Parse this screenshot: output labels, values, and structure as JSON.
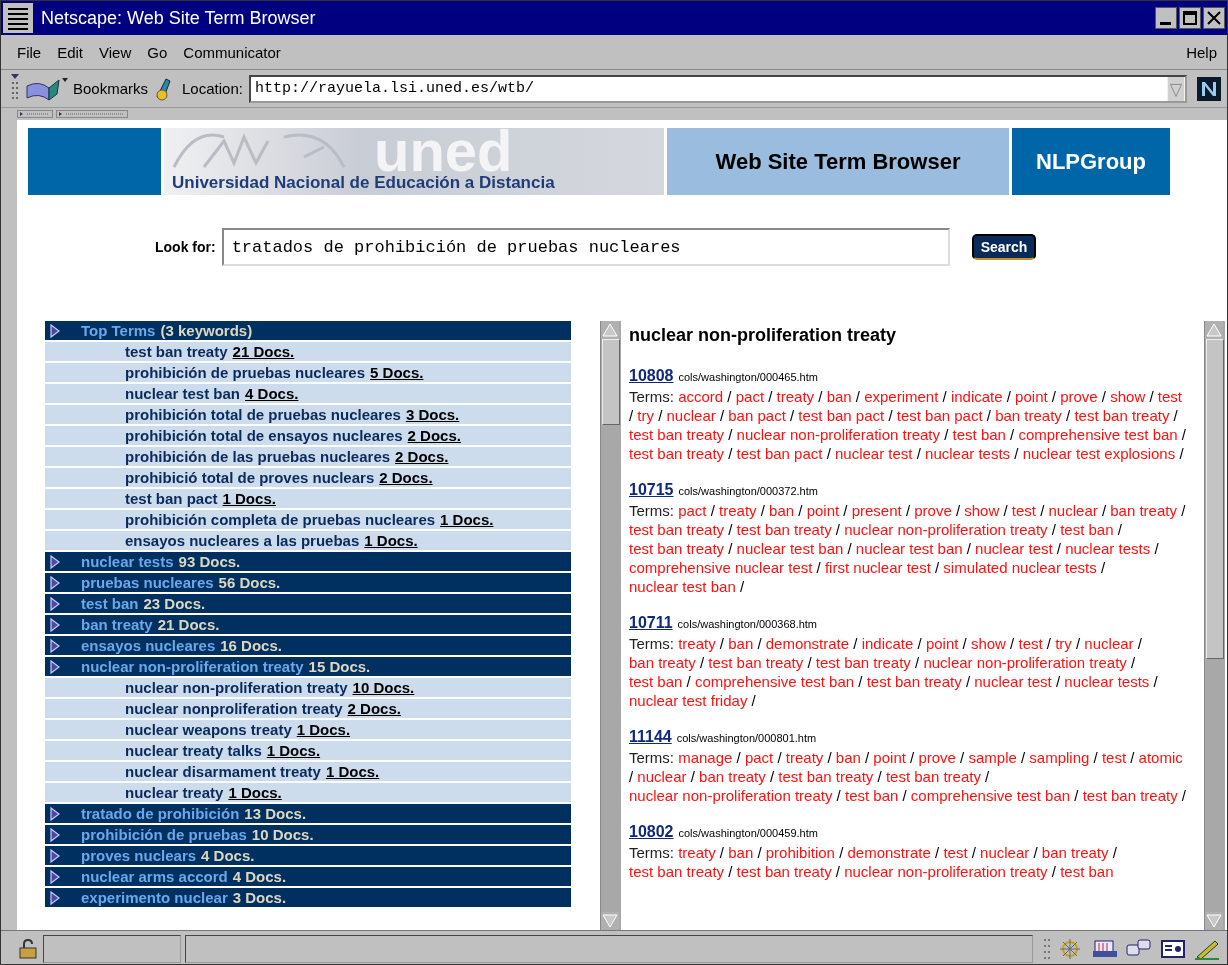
{
  "window": {
    "title": "Netscape: Web Site Term Browser"
  },
  "menu": {
    "items": [
      "File",
      "Edit",
      "View",
      "Go",
      "Communicator"
    ],
    "help": "Help"
  },
  "location_bar": {
    "bookmarks": "Bookmarks",
    "location_label": "Location:",
    "url": "http://rayuela.lsi.uned.es/wtb/"
  },
  "banner": {
    "logo_word": "uned",
    "university": "Universidad Nacional de Educación a Distancia",
    "title": "Web Site Term Browser",
    "group": "NLPGroup"
  },
  "search": {
    "label": "Look for:",
    "value": "tratados de prohibición de pruebas nucleares",
    "button": "Search"
  },
  "tree": [
    {
      "term": "Top Terms",
      "docs": "(3 keywords)",
      "children": [
        {
          "term": "test ban treaty",
          "docs": "21 Docs."
        },
        {
          "term": "prohibición de pruebas nucleares",
          "docs": "5 Docs."
        },
        {
          "term": "nuclear test ban",
          "docs": "4 Docs."
        },
        {
          "term": "prohibición total de pruebas nucleares",
          "docs": "3 Docs."
        },
        {
          "term": "prohibición total de ensayos nucleares",
          "docs": "2 Docs."
        },
        {
          "term": "prohibición de las pruebas nucleares",
          "docs": "2 Docs."
        },
        {
          "term": "prohibició total de proves nuclears",
          "docs": "2 Docs."
        },
        {
          "term": "test ban pact",
          "docs": "1 Docs."
        },
        {
          "term": "prohibición completa de pruebas nucleares",
          "docs": "1 Docs."
        },
        {
          "term": "ensayos nucleares a las pruebas",
          "docs": "1 Docs."
        }
      ]
    },
    {
      "term": "nuclear tests",
      "docs": "93 Docs."
    },
    {
      "term": "pruebas nucleares",
      "docs": "56 Docs."
    },
    {
      "term": "test ban",
      "docs": "23 Docs."
    },
    {
      "term": "ban treaty",
      "docs": "21 Docs."
    },
    {
      "term": "ensayos nucleares",
      "docs": "16 Docs."
    },
    {
      "term": "nuclear non-proliferation treaty",
      "docs": "15 Docs.",
      "children": [
        {
          "term": "nuclear non-proliferation treaty",
          "docs": "10 Docs."
        },
        {
          "term": "nuclear nonproliferation treaty",
          "docs": "2 Docs."
        },
        {
          "term": "nuclear weapons treaty",
          "docs": "1 Docs."
        },
        {
          "term": "nuclear treaty talks",
          "docs": "1 Docs."
        },
        {
          "term": "nuclear disarmament treaty",
          "docs": "1 Docs."
        },
        {
          "term": "nuclear treaty",
          "docs": "1 Docs."
        }
      ]
    },
    {
      "term": "tratado de prohibición",
      "docs": "13 Docs."
    },
    {
      "term": "prohibición de pruebas",
      "docs": "10 Docs."
    },
    {
      "term": "proves nuclears",
      "docs": "4 Docs."
    },
    {
      "term": "nuclear arms accord",
      "docs": "4 Docs."
    },
    {
      "term": "experimento nuclear",
      "docs": "3 Docs."
    }
  ],
  "results": {
    "heading": "nuclear non-proliferation treaty",
    "docs": [
      {
        "id": "10808",
        "path": "cols/washington/000465.htm",
        "terms_label": "Terms:",
        "terms": [
          {
            "term": "accord",
            "sep": "/"
          },
          {
            "term": "pact",
            "sep": "/"
          },
          {
            "term": "treaty",
            "sep": "/"
          },
          {
            "term": "ban",
            "sep": "/"
          },
          {
            "term": "experiment",
            "sep": "/"
          },
          {
            "term": "indicate",
            "sep": "/"
          },
          {
            "term": "point",
            "sep": "/"
          },
          {
            "term": "prove",
            "sep": "/"
          },
          {
            "term": "show",
            "sep": "/"
          },
          {
            "term": "test",
            "sep": "/"
          },
          {
            "term": "try",
            "sep": "/"
          },
          {
            "term": "nuclear",
            "sep": "/"
          },
          {
            "term": "ban pact",
            "sep": "/"
          },
          {
            "term": "test ban pact",
            "sep": "/"
          },
          {
            "term": "test ban pact",
            "sep": "/"
          },
          {
            "term": "ban treaty",
            "sep": "/"
          },
          {
            "term": "test ban treaty",
            "sep": "/"
          },
          {
            "term": "test ban treaty",
            "sep": "/"
          },
          {
            "term": "nuclear non-proliferation treaty",
            "sep": "/"
          },
          {
            "term": "test ban",
            "sep": "/"
          },
          {
            "term": "comprehensive test ban",
            "sep": "/"
          },
          {
            "term": "test ban treaty",
            "sep": "/"
          },
          {
            "term": "test ban pact",
            "sep": "/"
          },
          {
            "term": "nuclear test",
            "sep": "/"
          },
          {
            "term": "nuclear tests",
            "sep": "/"
          },
          {
            "term": "nuclear test explosions",
            "sep": "/"
          }
        ]
      },
      {
        "id": "10715",
        "path": "cols/washington/000372.htm",
        "terms_label": "Terms:",
        "terms": [
          {
            "term": "pact",
            "sep": "/"
          },
          {
            "term": "treaty",
            "sep": "/"
          },
          {
            "term": "ban",
            "sep": "/"
          },
          {
            "term": "point",
            "sep": "/"
          },
          {
            "term": "present",
            "sep": "/"
          },
          {
            "term": "prove",
            "sep": "/"
          },
          {
            "term": "show",
            "sep": "/"
          },
          {
            "term": "test",
            "sep": "/"
          },
          {
            "term": "nuclear",
            "sep": "/"
          },
          {
            "term": "ban treaty",
            "sep": "/"
          },
          {
            "term": "test ban treaty",
            "sep": "/"
          },
          {
            "term": "test ban treaty",
            "sep": "/"
          },
          {
            "term": "nuclear non-proliferation treaty",
            "sep": "/"
          },
          {
            "term": "test ban",
            "sep": "/"
          },
          {
            "term": "test ban treaty",
            "sep": "/"
          },
          {
            "term": "nuclear test ban",
            "sep": "/"
          },
          {
            "term": "nuclear test ban",
            "sep": "/"
          },
          {
            "term": "nuclear test",
            "sep": "/"
          },
          {
            "term": "nuclear tests",
            "sep": "/"
          },
          {
            "term": "comprehensive nuclear test",
            "sep": "/"
          },
          {
            "term": "first nuclear test",
            "sep": "/"
          },
          {
            "term": "simulated nuclear tests",
            "sep": "/"
          },
          {
            "term": "nuclear test ban",
            "sep": "/"
          }
        ]
      },
      {
        "id": "10711",
        "path": "cols/washington/000368.htm",
        "terms_label": "Terms:",
        "terms": [
          {
            "term": "treaty",
            "sep": "/"
          },
          {
            "term": "ban",
            "sep": "/"
          },
          {
            "term": "demonstrate",
            "sep": "/"
          },
          {
            "term": "indicate",
            "sep": "/"
          },
          {
            "term": "point",
            "sep": "/"
          },
          {
            "term": "show",
            "sep": "/"
          },
          {
            "term": "test",
            "sep": "/"
          },
          {
            "term": "try",
            "sep": "/"
          },
          {
            "term": "nuclear",
            "sep": "/"
          },
          {
            "term": "ban treaty",
            "sep": "/"
          },
          {
            "term": "test ban treaty",
            "sep": "/"
          },
          {
            "term": "test ban treaty",
            "sep": "/"
          },
          {
            "term": "nuclear non-proliferation treaty",
            "sep": "/"
          },
          {
            "term": "test ban",
            "sep": "/"
          },
          {
            "term": "comprehensive test ban",
            "sep": "/"
          },
          {
            "term": "test ban treaty",
            "sep": "/"
          },
          {
            "term": "nuclear test",
            "sep": "/"
          },
          {
            "term": "nuclear tests",
            "sep": "/"
          },
          {
            "term": "nuclear test friday",
            "sep": "/"
          }
        ]
      },
      {
        "id": "11144",
        "path": "cols/washington/000801.htm",
        "terms_label": "Terms:",
        "terms": [
          {
            "term": "manage",
            "sep": "/"
          },
          {
            "term": "pact",
            "sep": "/"
          },
          {
            "term": "treaty",
            "sep": "/"
          },
          {
            "term": "ban",
            "sep": "/"
          },
          {
            "term": "point",
            "sep": "/"
          },
          {
            "term": "prove",
            "sep": "/"
          },
          {
            "term": "sample",
            "sep": "/"
          },
          {
            "term": "sampling",
            "sep": "/"
          },
          {
            "term": "test",
            "sep": "/"
          },
          {
            "term": "atomic",
            "sep": "/"
          },
          {
            "term": "nuclear",
            "sep": "/"
          },
          {
            "term": "ban treaty",
            "sep": "/"
          },
          {
            "term": "test ban treaty",
            "sep": "/"
          },
          {
            "term": "test ban treaty",
            "sep": "/"
          },
          {
            "term": "nuclear non-proliferation treaty",
            "sep": "/"
          },
          {
            "term": "test ban",
            "sep": "/"
          },
          {
            "term": "comprehensive test ban",
            "sep": "/"
          },
          {
            "term": "test ban treaty",
            "sep": "/"
          }
        ]
      },
      {
        "id": "10802",
        "path": "cols/washington/000459.htm",
        "terms_label": "Terms:",
        "terms": [
          {
            "term": "treaty",
            "sep": "/"
          },
          {
            "term": "ban",
            "sep": "/"
          },
          {
            "term": "prohibition",
            "sep": "/"
          },
          {
            "term": "demonstrate",
            "sep": "/"
          },
          {
            "term": "test",
            "sep": "/"
          },
          {
            "term": "nuclear",
            "sep": "/"
          },
          {
            "term": "ban treaty",
            "sep": "/"
          },
          {
            "term": "test ban treaty",
            "sep": "/"
          },
          {
            "term": "test ban treaty",
            "sep": "/"
          },
          {
            "term": "nuclear non-proliferation treaty",
            "sep": "/"
          },
          {
            "term": "test ban"
          }
        ]
      }
    ]
  }
}
